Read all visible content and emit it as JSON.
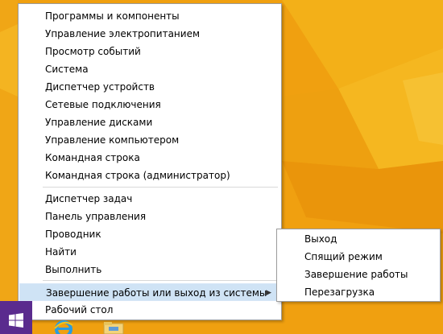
{
  "menu": {
    "items": [
      {
        "label": "Программы и компоненты"
      },
      {
        "label": "Управление электропитанием"
      },
      {
        "label": "Просмотр событий"
      },
      {
        "label": "Система"
      },
      {
        "label": "Диспетчер устройств"
      },
      {
        "label": "Сетевые подключения"
      },
      {
        "label": "Управление дисками"
      },
      {
        "label": "Управление компьютером"
      },
      {
        "label": "Командная строка"
      },
      {
        "label": "Командная строка (администратор)"
      },
      {
        "label": "Диспетчер задач"
      },
      {
        "label": "Панель управления"
      },
      {
        "label": "Проводник"
      },
      {
        "label": "Найти"
      },
      {
        "label": "Выполнить"
      },
      {
        "label": "Завершение работы или выход из системы"
      },
      {
        "label": "Рабочий стол"
      }
    ],
    "submenu_arrow": "▶"
  },
  "submenu": {
    "items": [
      {
        "label": "Выход"
      },
      {
        "label": "Спящий режим"
      },
      {
        "label": "Завершение работы"
      },
      {
        "label": "Перезагрузка"
      }
    ]
  },
  "taskbar": {
    "start_icon": "windows-logo-icon",
    "icons": [
      "internet-explorer-icon",
      "file-explorer-icon"
    ]
  },
  "colors": {
    "desktop": "#f3a313",
    "start_button": "#5a2b8e",
    "highlight": "#cfe3f5"
  }
}
